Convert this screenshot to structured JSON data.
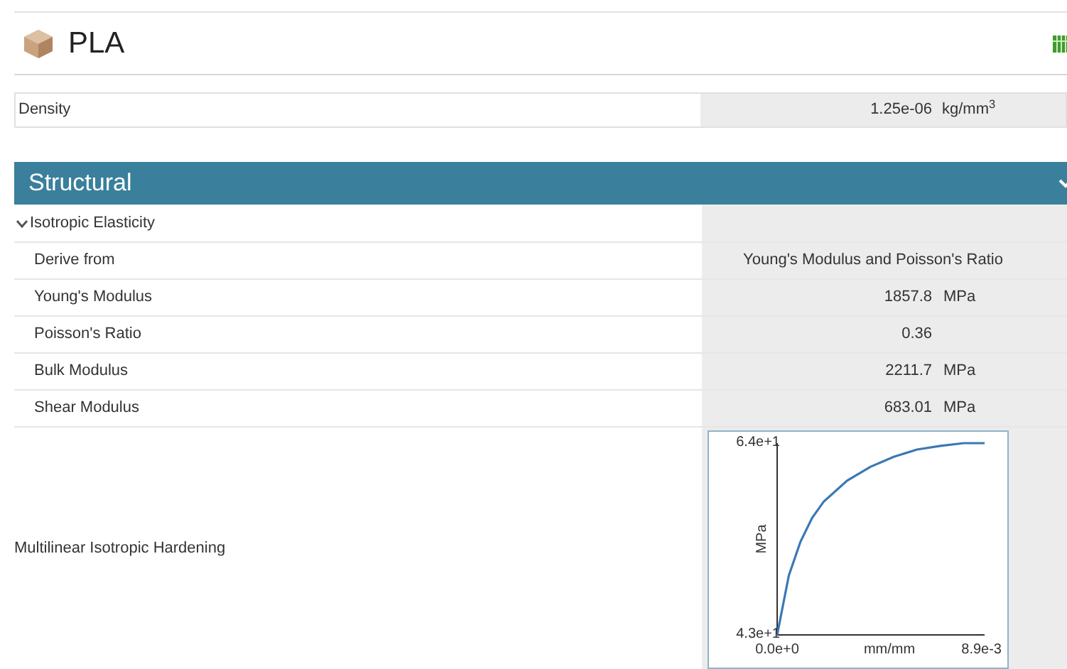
{
  "material": {
    "name": "PLA"
  },
  "density": {
    "label": "Density",
    "value": "1.25e-06",
    "unit": "kg/mm$^{3}$"
  },
  "section": {
    "title": "Structural",
    "expanded": true,
    "group": {
      "label": "Isotropic Elasticity",
      "expanded": true,
      "rows": [
        {
          "label": "Derive from",
          "value": "Young's Modulus and Poisson's Ratio",
          "unit": ""
        },
        {
          "label": "Young's Modulus",
          "value": "1857.8",
          "unit": "MPa"
        },
        {
          "label": "Poisson's Ratio",
          "value": "0.36",
          "unit": ""
        },
        {
          "label": "Bulk Modulus",
          "value": "2211.7",
          "unit": "MPa"
        },
        {
          "label": "Shear Modulus",
          "value": "683.01",
          "unit": "MPa"
        }
      ]
    },
    "hardening": {
      "label": "Multilinear Isotropic Hardening",
      "chart_data": {
        "type": "line",
        "xlabel": "mm/mm",
        "ylabel": "MPa",
        "xlim": [
          0,
          0.0089
        ],
        "ylim": [
          43,
          64
        ],
        "xticks": [
          {
            "value": 0,
            "label": "0.0e+0"
          },
          {
            "value": 0.0089,
            "label": "8.9e-3"
          }
        ],
        "yticks": [
          {
            "value": 43,
            "label": "4.3e+1"
          },
          {
            "value": 64,
            "label": "6.4e+1"
          }
        ],
        "x": [
          0,
          0.0005,
          0.001,
          0.0015,
          0.002,
          0.003,
          0.004,
          0.005,
          0.006,
          0.007,
          0.008,
          0.0089
        ],
        "series": [
          {
            "color": "#3a78b5",
            "values": [
              43,
              49.5,
              53.2,
              55.8,
              57.6,
              59.9,
              61.4,
              62.5,
              63.3,
              63.7,
              64,
              64
            ]
          }
        ]
      }
    }
  }
}
